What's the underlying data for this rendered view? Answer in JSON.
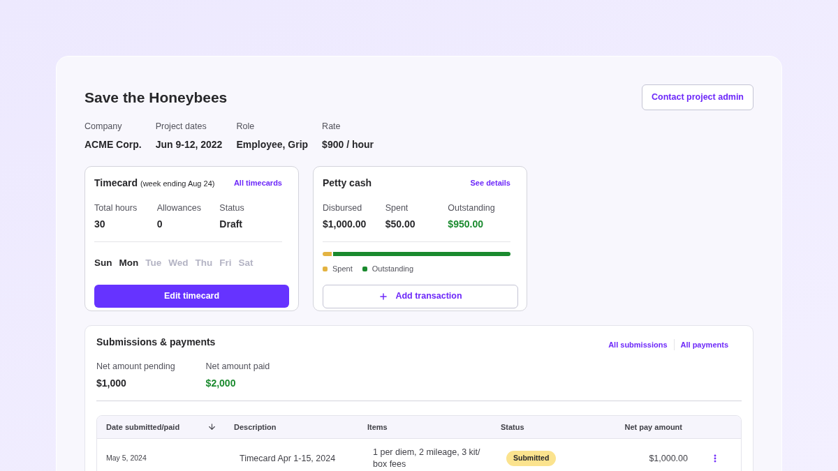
{
  "project": {
    "title": "Save the Honeybees",
    "contact_button": "Contact project admin",
    "details": [
      {
        "label": "Company",
        "value": "ACME Corp."
      },
      {
        "label": "Project dates",
        "value": "Jun 9-12, 2022"
      },
      {
        "label": "Role",
        "value": "Employee, Grip"
      },
      {
        "label": "Rate",
        "value": "$900 / hour"
      }
    ]
  },
  "timecard": {
    "title": "Timecard",
    "subtitle": "(week ending Aug 24)",
    "link": "All timecards",
    "stats": [
      {
        "label": "Total hours",
        "value": "30"
      },
      {
        "label": "Allowances",
        "value": "0"
      },
      {
        "label": "Status",
        "value": "Draft"
      }
    ],
    "days": [
      {
        "label": "Sun",
        "logged": true
      },
      {
        "label": "Mon",
        "logged": true
      },
      {
        "label": "Tue",
        "logged": false
      },
      {
        "label": "Wed",
        "logged": false
      },
      {
        "label": "Thu",
        "logged": false
      },
      {
        "label": "Fri",
        "logged": false
      },
      {
        "label": "Sat",
        "logged": false
      }
    ],
    "button": "Edit timecard"
  },
  "petty_cash": {
    "title": "Petty cash",
    "link": "See details",
    "stats": [
      {
        "label": "Disbursed",
        "value": "$1,000.00",
        "positive": false
      },
      {
        "label": "Spent",
        "value": "$50.00",
        "positive": false
      },
      {
        "label": "Outstanding",
        "value": "$950.00",
        "positive": true
      }
    ],
    "bar": {
      "level": 0.05
    },
    "legend": [
      {
        "label": "Spent",
        "color": "#e3b341"
      },
      {
        "label": "Outstanding",
        "color": "#1a8a2e"
      }
    ],
    "button": "Add transaction"
  },
  "submissions": {
    "title": "Submissions & payments",
    "links": [
      "All submissions",
      "All payments"
    ],
    "stats": [
      {
        "label": "Net amount pending",
        "value": "$1,000",
        "positive": false
      },
      {
        "label": "Net amount paid",
        "value": "$2,000",
        "positive": true
      }
    ],
    "table": {
      "columns": [
        "Date submitted/paid",
        "Description",
        "Items",
        "Status",
        "Net pay amount"
      ],
      "rows": [
        {
          "date": "May 5, 2024",
          "description": "Timecard Apr 1-15, 2024",
          "items": "1 per diem, 2 mileage, 3 kit/ box fees",
          "status": "Submitted",
          "amount": "$1,000.00"
        }
      ]
    }
  }
}
